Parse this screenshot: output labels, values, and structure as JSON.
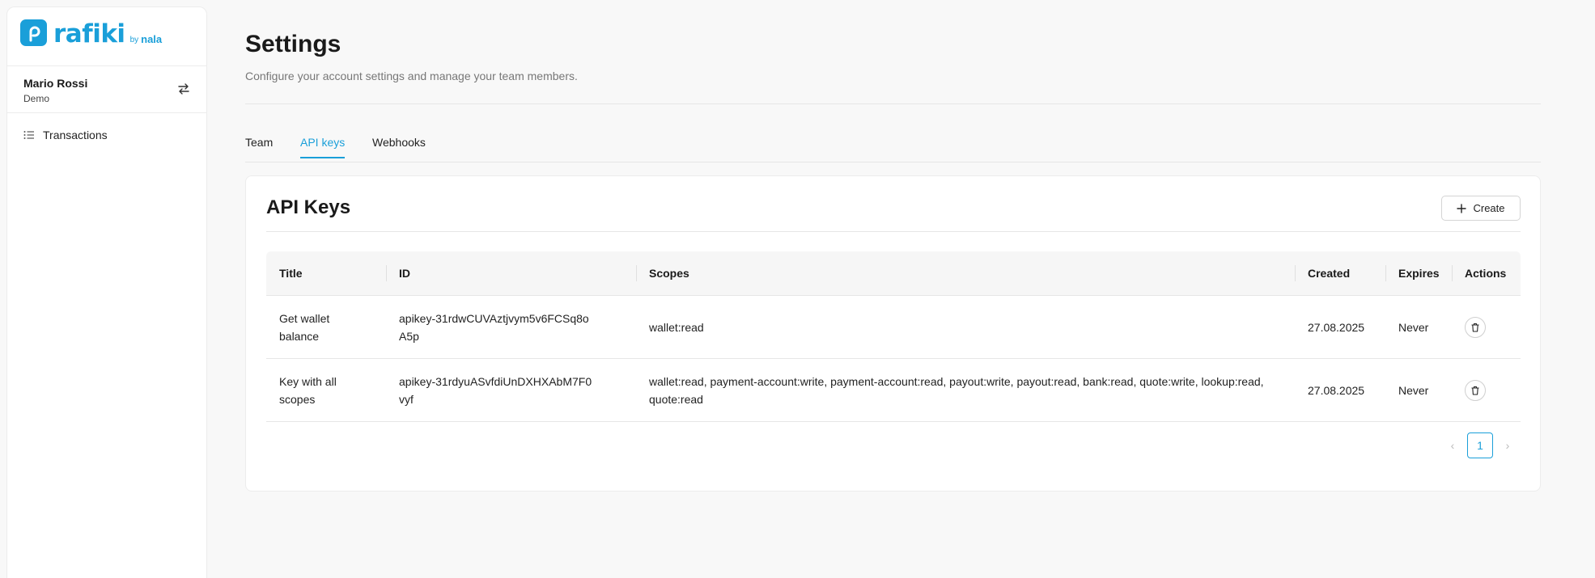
{
  "brand": {
    "name": "rafiki",
    "by": "by",
    "partner": "nala",
    "accent": "#1a9fd9"
  },
  "user": {
    "name": "Mario Rossi",
    "org": "Demo"
  },
  "sidebar": {
    "items": [
      {
        "label": "Transactions",
        "icon": "list-icon"
      }
    ]
  },
  "header": {
    "title": "Settings",
    "subtitle": "Configure your account settings and manage your team members."
  },
  "tabs": [
    {
      "label": "Team",
      "active": false
    },
    {
      "label": "API keys",
      "active": true
    },
    {
      "label": "Webhooks",
      "active": false
    }
  ],
  "api_keys": {
    "title": "API Keys",
    "create_label": "Create",
    "columns": [
      "Title",
      "ID",
      "Scopes",
      "Created",
      "Expires",
      "Actions"
    ],
    "rows": [
      {
        "title": "Get wallet balance",
        "id": "apikey-31rdwCUVAztjvym5v6FCSq8oA5p",
        "scopes": "wallet:read",
        "created": "27.08.2025",
        "expires": "Never"
      },
      {
        "title": "Key with all scopes",
        "id": "apikey-31rdyuASvfdiUnDXHXAbM7F0vyf",
        "scopes": "wallet:read, payment-account:write, payment-account:read, payout:write, payout:read, bank:read, quote:write, lookup:read, quote:read",
        "created": "27.08.2025",
        "expires": "Never"
      }
    ],
    "pagination": {
      "current_page": "1",
      "prev": "‹",
      "next": "›"
    }
  }
}
